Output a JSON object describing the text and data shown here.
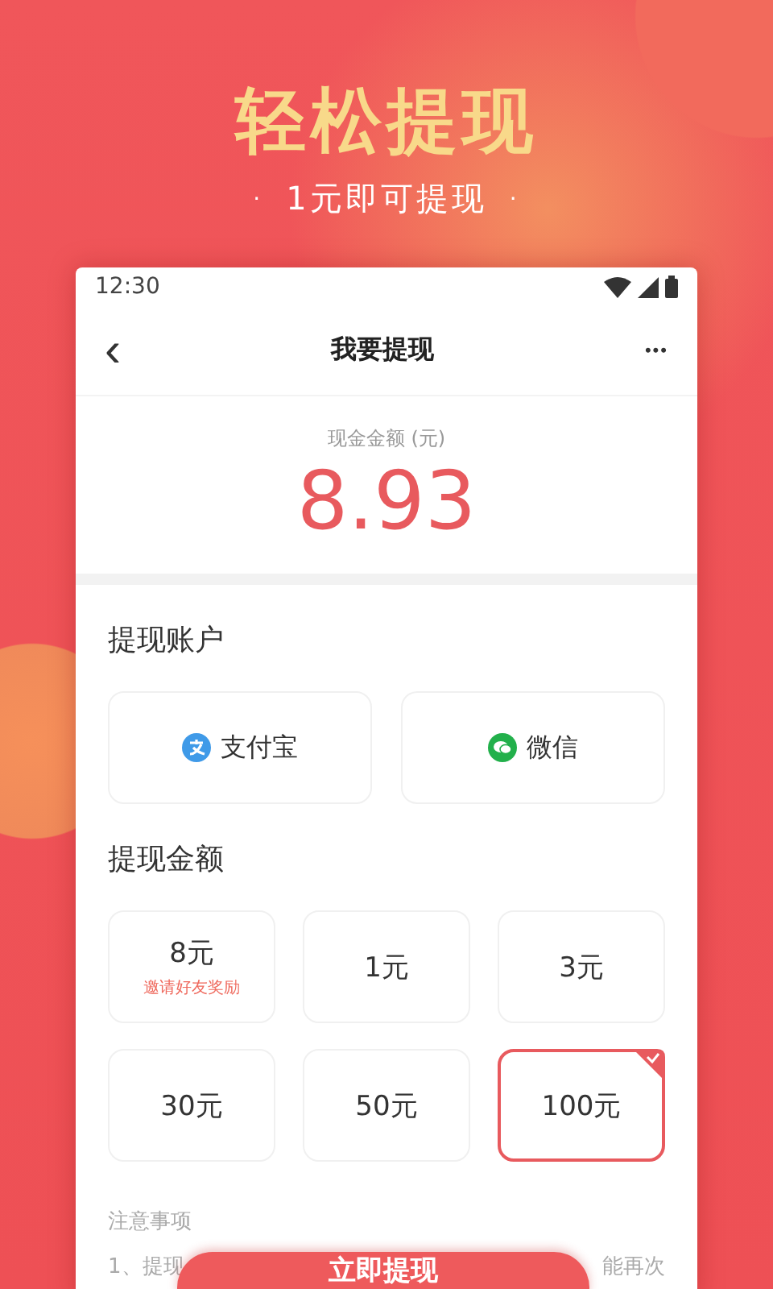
{
  "hero": {
    "title": "轻松提现",
    "subtitle": "1元即可提现",
    "dot": "·"
  },
  "status_bar": {
    "time": "12:30"
  },
  "nav": {
    "back": "‹",
    "title": "我要提现",
    "more": "•••"
  },
  "balance": {
    "label": "现金金额 (元)",
    "amount": "8.93"
  },
  "accounts_title": "提现账户",
  "accounts": [
    {
      "kind": "alipay",
      "label": "支付宝"
    },
    {
      "kind": "wechat",
      "label": "微信"
    }
  ],
  "amounts_title": "提现金额",
  "amounts": [
    {
      "label": "8元",
      "note": "邀请好友奖励",
      "selected": false
    },
    {
      "label": "1元",
      "selected": false
    },
    {
      "label": "3元",
      "selected": false
    },
    {
      "label": "30元",
      "selected": false
    },
    {
      "label": "50元",
      "selected": false
    },
    {
      "label": "100元",
      "selected": true
    }
  ],
  "notes": {
    "title": "注意事项",
    "line_start": "1、提现",
    "line_end": "能再次"
  },
  "submit_button": "立即提现"
}
